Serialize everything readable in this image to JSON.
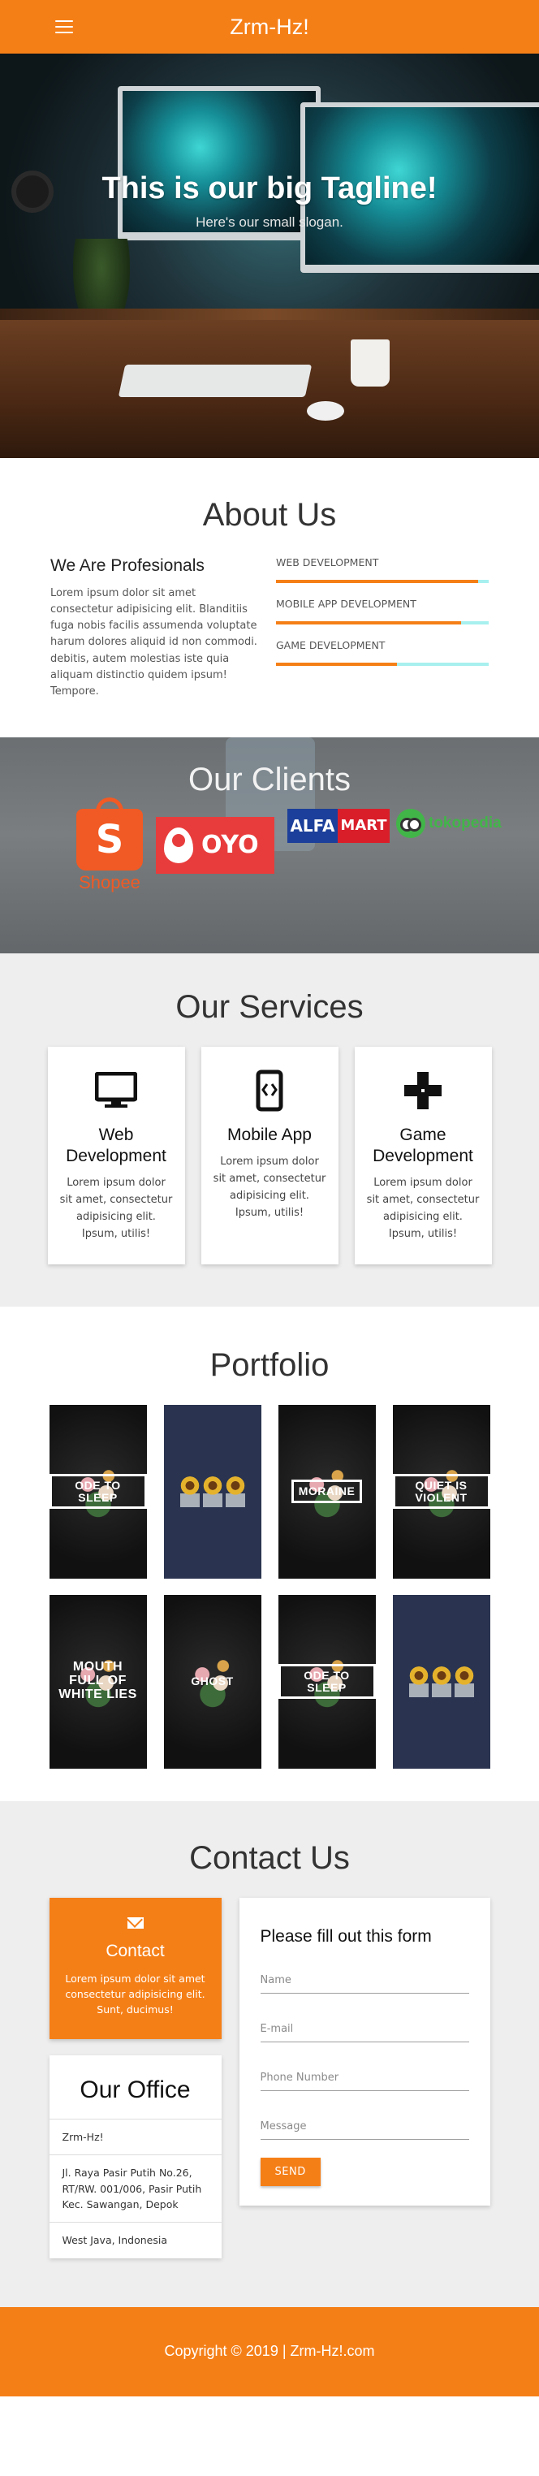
{
  "navbar": {
    "brand": "Zrm-Hz!"
  },
  "hero": {
    "title": "This is our big Tagline!",
    "subtitle": "Here's our small slogan."
  },
  "about": {
    "title": "About Us",
    "subheading": "We Are Profesionals",
    "text": "Lorem ipsum dolor sit amet consectetur adipisicing elit. Blanditiis fuga nobis facilis assumenda voluptate harum dolores aliquid id non commodi. debitis, autem molestias iste quia aliquam distinctio quidem ipsum! Tempore.",
    "skills": [
      {
        "label": "WEB DEVELOPMENT",
        "percent": 95
      },
      {
        "label": "MOBILE APP DEVELOPMENT",
        "percent": 87
      },
      {
        "label": "GAME DEVELOPMENT",
        "percent": 57
      }
    ]
  },
  "clients": {
    "title": "Our Clients",
    "logos": {
      "shopee": "Shopee",
      "shopee_mark": "S",
      "oyo": "OYO",
      "alfamart_left": "ALFA",
      "alfamart_right": "MART",
      "tokopedia": "tokopedia"
    }
  },
  "services": {
    "title": "Our Services",
    "items": [
      {
        "title": "Web Development",
        "icon": "monitor-icon",
        "text": "Lorem ipsum dolor sit amet, consectetur adipisicing elit. Ipsum, utilis!"
      },
      {
        "title": "Mobile App",
        "icon": "mobile-icon",
        "text": "Lorem ipsum dolor sit amet, consectetur adipisicing elit. Ipsum, utilis!"
      },
      {
        "title": "Game Development",
        "icon": "gamepad-icon",
        "text": "Lorem ipsum dolor sit amet, consectetur adipisicing elit. Ipsum, utilis!"
      }
    ]
  },
  "portfolio": {
    "title": "Portfolio",
    "items": [
      {
        "label": "ODE TO SLEEP",
        "style": "dark"
      },
      {
        "label": "",
        "style": "navy"
      },
      {
        "label": "MORAINE",
        "style": "dark"
      },
      {
        "label": "QUIET IS VIOLENT",
        "style": "dark"
      },
      {
        "label": "MOUTH FULL OF WHITE LIES",
        "style": "dark"
      },
      {
        "label": "GHOST",
        "style": "dark"
      },
      {
        "label": "ODE TO SLEEP",
        "style": "dark"
      },
      {
        "label": "",
        "style": "navy"
      }
    ]
  },
  "contact": {
    "title": "Contact Us",
    "card_title": "Contact",
    "card_text": "Lorem ipsum dolor sit amet consectetur adipisicing elit. Sunt, ducimus!",
    "office_title": "Our Office",
    "office_lines": [
      "Zrm-Hz!",
      "Jl. Raya Pasir Putih No.26, RT/RW. 001/006, Pasir Putih Kec. Sawangan, Depok",
      "West Java, Indonesia"
    ],
    "form_title": "Please fill out this form",
    "fields": {
      "name": "Name",
      "email": "E-mail",
      "phone": "Phone Number",
      "message": "Message"
    },
    "send": "SEND"
  },
  "footer": {
    "text": "Copyright © 2019 | Zrm-Hz!.com"
  },
  "colors": {
    "accent": "#f57f17",
    "skill_track": "#a7f0ef"
  }
}
